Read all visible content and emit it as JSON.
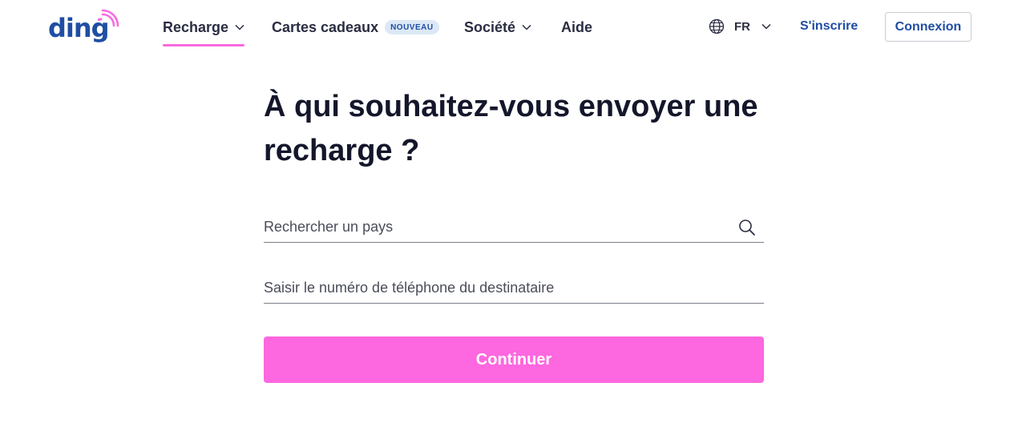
{
  "brand": {
    "logo_text": "ding",
    "accent": "#f96bdf",
    "primary": "#1f4ea3"
  },
  "nav": {
    "recharge": "Recharge",
    "cartes": "Cartes cadeaux",
    "cartes_badge": "NOUVEAU",
    "societe": "Société",
    "aide": "Aide"
  },
  "header_right": {
    "language": "FR",
    "signup": "S'inscrire",
    "login": "Connexion"
  },
  "main": {
    "title": "À qui souhaitez-vous envoyer une recharge ?",
    "country_placeholder": "Rechercher un pays",
    "phone_placeholder": "Saisir le numéro de téléphone du destinataire",
    "continue_label": "Continuer"
  },
  "icons": {
    "search": "search-icon",
    "globe": "globe-icon",
    "chevron": "chevron-down-icon",
    "signal": "signal-waves-icon"
  }
}
